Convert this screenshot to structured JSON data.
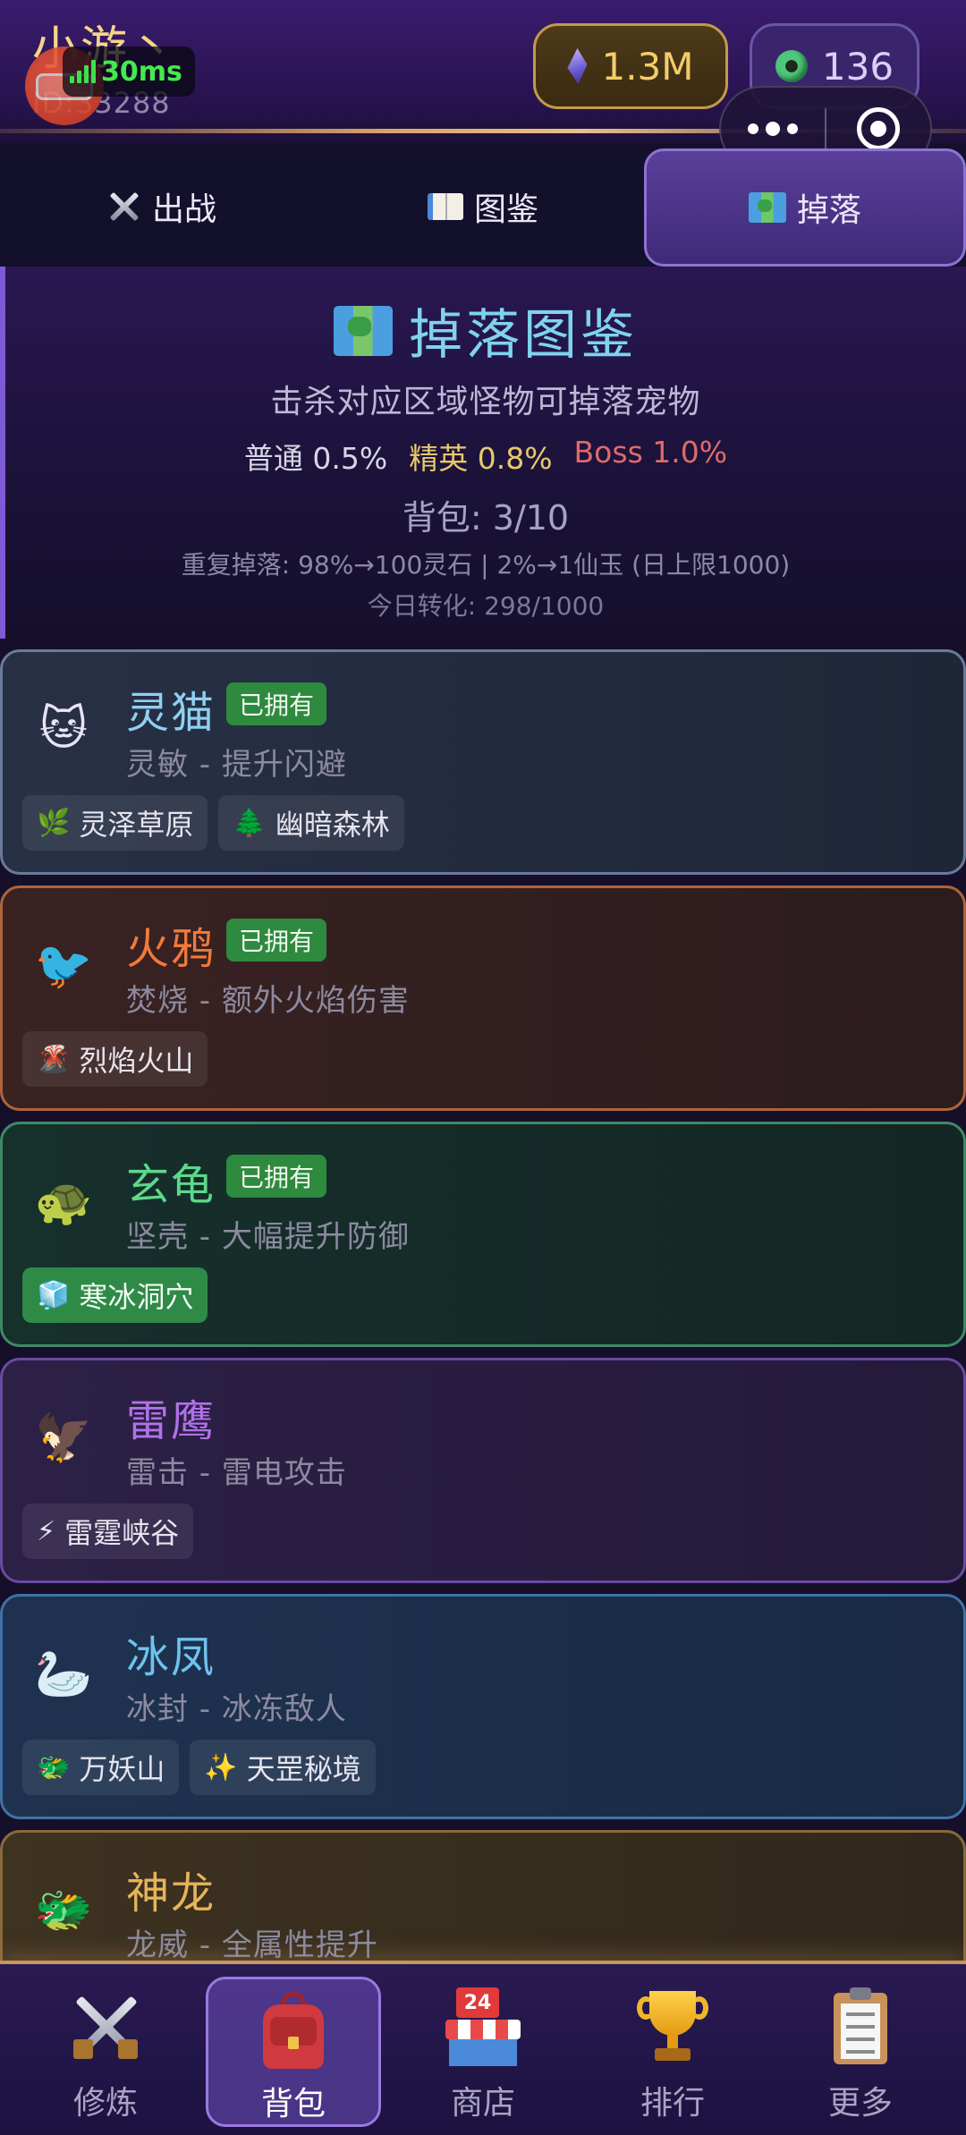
{
  "header": {
    "player_name": "小游丶",
    "player_id": "ID:33288",
    "ping": "30ms",
    "spirit_stones": "1.3M",
    "jade": "136"
  },
  "tabs": [
    {
      "label": "出战",
      "icon": "crossed-swords-icon"
    },
    {
      "label": "图鉴",
      "icon": "book-icon"
    },
    {
      "label": "掉落",
      "icon": "map-icon",
      "active": true
    }
  ],
  "drop_info": {
    "title": "掉落图鉴",
    "subtitle": "击杀对应区域怪物可掉落宠物",
    "rate_normal": "普通 0.5%",
    "rate_elite": "精英 0.8%",
    "rate_boss": "Boss 1.0%",
    "bag": "背包: 3/10",
    "duplicate_rule": "重复掉落: 98%→100灵石 | 2%→1仙玉 (日上限1000)",
    "today": "今日转化: 298/1000"
  },
  "pets": [
    {
      "name": "灵猫",
      "emoji": "🐱",
      "owned": true,
      "desc": "灵敏 - 提升闪避",
      "regions": [
        {
          "icon": "🌿",
          "name": "灵泽草原"
        },
        {
          "icon": "🌲",
          "name": "幽暗森林"
        }
      ]
    },
    {
      "name": "火鸦",
      "emoji": "🐦",
      "owned": true,
      "desc": "焚烧 - 额外火焰伤害",
      "regions": [
        {
          "icon": "🌋",
          "name": "烈焰火山"
        }
      ]
    },
    {
      "name": "玄龟",
      "emoji": "🐢",
      "owned": true,
      "desc": "坚壳 - 大幅提升防御",
      "regions": [
        {
          "icon": "🧊",
          "name": "寒冰洞穴"
        }
      ]
    },
    {
      "name": "雷鹰",
      "emoji": "🦅",
      "owned": false,
      "desc": "雷击 - 雷电攻击",
      "regions": [
        {
          "icon": "⚡",
          "name": "雷霆峡谷"
        }
      ]
    },
    {
      "name": "冰凤",
      "emoji": "🦢",
      "owned": false,
      "desc": "冰封 - 冰冻敌人",
      "regions": [
        {
          "icon": "🐲",
          "name": "万妖山"
        },
        {
          "icon": "✨",
          "name": "天罡秘境"
        }
      ]
    },
    {
      "name": "神龙",
      "emoji": "🐲",
      "owned": false,
      "desc": "龙威 - 全属性提升",
      "regions": []
    }
  ],
  "owned_label": "已拥有",
  "bottom_nav": [
    {
      "label": "修炼",
      "icon": "crossed-swords-icon"
    },
    {
      "label": "背包",
      "icon": "backpack-icon",
      "active": true
    },
    {
      "label": "商店",
      "icon": "shop-icon",
      "badge": "24"
    },
    {
      "label": "排行",
      "icon": "trophy-icon"
    },
    {
      "label": "更多",
      "icon": "clipboard-icon"
    }
  ],
  "colors": {
    "accent_purple": "#7f5ad6",
    "gold": "#f3cd6a",
    "owned_green": "#2e8a3e",
    "title_cyan": "#7fd3ee"
  }
}
